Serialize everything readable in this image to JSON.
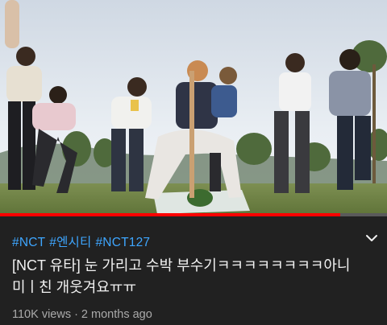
{
  "video": {
    "progress_percent": 88
  },
  "hashtags": [
    "#NCT",
    "#엔시티",
    "#NCT127"
  ],
  "title": "[NCT 유타] 눈 가리고 수박 부수기ㅋㅋㅋㅋㅋㅋㅋㅋ아니 미ㅣ친 개웃겨요ㅠㅠ",
  "meta": {
    "views": "110K views",
    "separator": "·",
    "age": "2 months ago"
  },
  "icons": {
    "expand": "chevron-down-icon"
  },
  "colors": {
    "background": "#212121",
    "hashtag": "#3ea6ff",
    "progress": "#ff0000",
    "title": "#f1f1f1",
    "meta": "#aaaaaa"
  }
}
